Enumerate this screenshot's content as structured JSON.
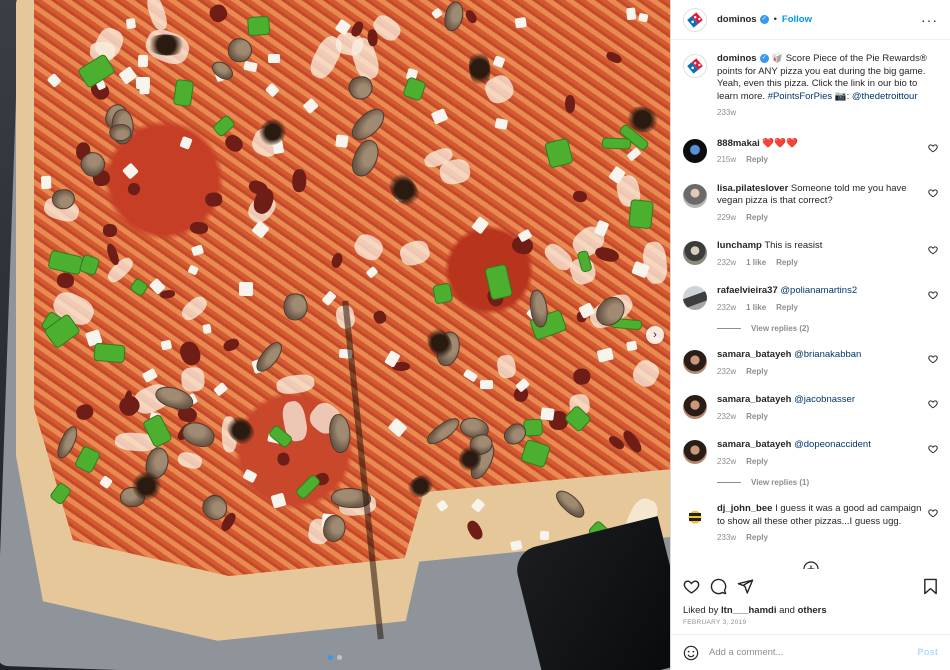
{
  "header": {
    "username": "dominos",
    "follow_label": "Follow",
    "separator": "•"
  },
  "caption": {
    "username": "dominos",
    "emoji": "🥡",
    "text_before": " Score Piece of the Pie Rewards® points for ANY pizza you eat during the big game. Yeah, even this pizza. Click the link in our bio to learn more. ",
    "hashtag": "#PointsForPies",
    "camera": " 📷: ",
    "mention": "@thedetroittour",
    "time": "233w"
  },
  "comments": [
    {
      "username": "888makai",
      "text": " ❤️❤️❤️",
      "time": "215w",
      "likes": "",
      "reply": "Reply",
      "avatar": "dark"
    },
    {
      "username": "lisa.pilateslover",
      "text": " Someone told me you have vegan pizza is that correct?",
      "time": "229w",
      "likes": "",
      "reply": "Reply",
      "avatar": "photo"
    },
    {
      "username": "lunchamp",
      "text": " This is reasist",
      "time": "232w",
      "likes": "1 like",
      "reply": "Reply",
      "avatar": "photo2"
    },
    {
      "username": "rafaelvieira37",
      "mention": "@polianamartins2",
      "time": "232w",
      "likes": "1 like",
      "reply": "Reply",
      "avatar": "photo3",
      "view_replies": "View replies (2)"
    },
    {
      "username": "samara_batayeh",
      "mention": "@brianakabban",
      "time": "232w",
      "likes": "",
      "reply": "Reply",
      "avatar": "photo4"
    },
    {
      "username": "samara_batayeh",
      "mention": "@jacobnasser",
      "time": "232w",
      "likes": "",
      "reply": "Reply",
      "avatar": "photo4"
    },
    {
      "username": "samara_batayeh",
      "mention": "@dopeonaccident",
      "time": "232w",
      "likes": "",
      "reply": "Reply",
      "avatar": "photo4",
      "view_replies": "View replies (1)"
    },
    {
      "username": "dj_john_bee",
      "text": " I guess it was a good ad campaign to show all these other pizzas...I guess ugg.",
      "time": "233w",
      "likes": "",
      "reply": "Reply",
      "avatar": "bee"
    }
  ],
  "likes": {
    "prefix": "Liked by ",
    "user": "ltn___hamdi",
    "middle": " and ",
    "others": "others"
  },
  "date": "FEBRUARY 3, 2019",
  "add_comment": {
    "placeholder": "Add a comment...",
    "post_label": "Post"
  },
  "icons": {
    "like": "heart-icon",
    "comment": "comment-icon",
    "share": "share-icon",
    "save": "bookmark-icon",
    "emoji": "emoji-icon",
    "more": "more-options-icon",
    "load_more": "plus-circle-icon"
  },
  "colors": {
    "link_blue": "#0095f6",
    "verified_blue": "#3897f0",
    "mention": "#00376b",
    "muted": "#8e8e8e",
    "post_disabled": "#b2dffc"
  }
}
